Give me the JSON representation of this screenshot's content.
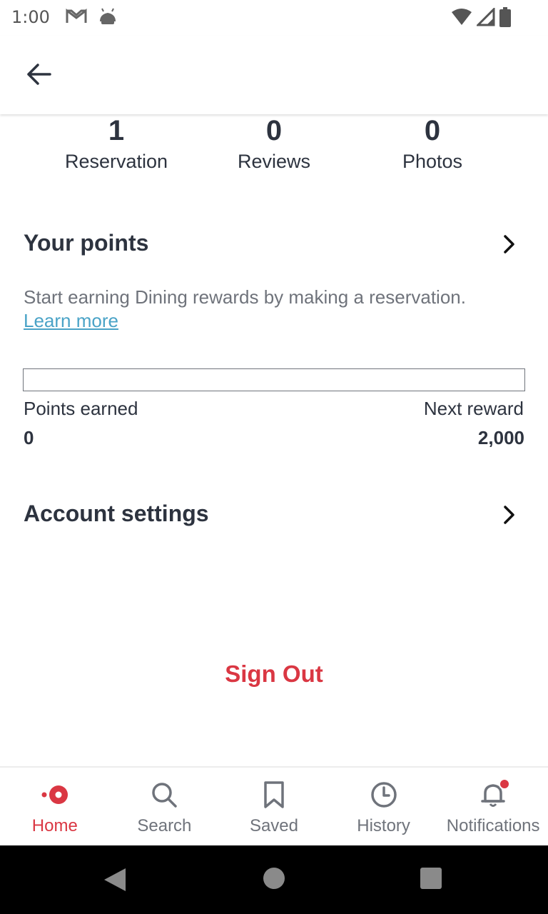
{
  "status_bar": {
    "time": "1:00",
    "left_icons": [
      "gmail-icon",
      "android-icon"
    ],
    "right_icons": [
      "wifi-icon",
      "signal-icon",
      "battery-icon"
    ]
  },
  "app_bar": {
    "back_icon": "arrow-left-icon"
  },
  "stats": [
    {
      "count": "1",
      "label": "Reservation"
    },
    {
      "count": "0",
      "label": "Reviews"
    },
    {
      "count": "0",
      "label": "Photos"
    }
  ],
  "points": {
    "title": "Your points",
    "description": "Start earning Dining rewards by making a reservation.",
    "learn_more": "Learn more",
    "progress": 0,
    "earned_label": "Points earned",
    "earned_value": "0",
    "next_label": "Next reward",
    "next_value": "2,000"
  },
  "account_settings": {
    "title": "Account settings"
  },
  "sign_out": "Sign Out",
  "bottom_nav": {
    "items": [
      {
        "label": "Home",
        "icon": "home-dot-icon",
        "active": true
      },
      {
        "label": "Search",
        "icon": "search-icon",
        "active": false
      },
      {
        "label": "Saved",
        "icon": "bookmark-icon",
        "active": false
      },
      {
        "label": "History",
        "icon": "clock-icon",
        "active": false
      },
      {
        "label": "Notifications",
        "icon": "bell-icon",
        "active": false,
        "badge": true
      }
    ]
  },
  "colors": {
    "accent": "#da3743",
    "link": "#4aa3c7",
    "text": "#2d333f",
    "muted": "#6f737b"
  }
}
